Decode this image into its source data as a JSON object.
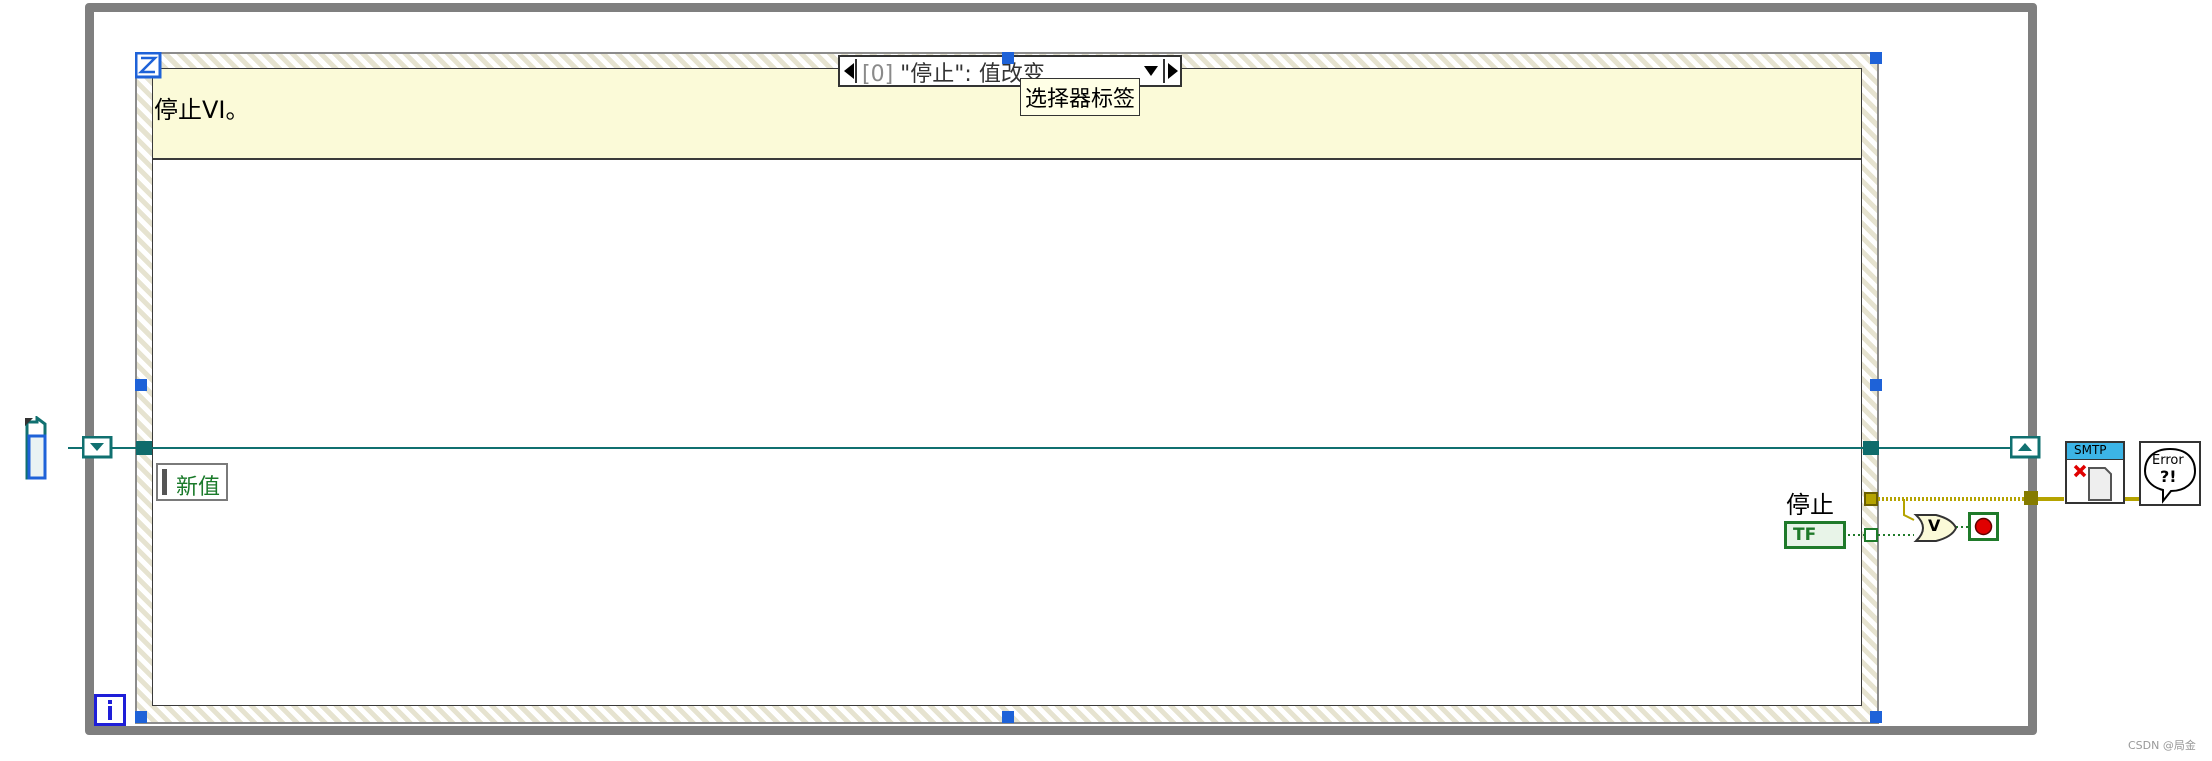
{
  "event_structure": {
    "selector_index": "[0]",
    "selector_text": "\"停止\": 值改变",
    "tooltip": "选择器标签",
    "description": "停止VI。",
    "event_data_field": "新值"
  },
  "stop_control": {
    "label": "停止",
    "terminal_text": "TF"
  },
  "or_node_text": "V",
  "smtp_icon_text": "SMTP",
  "error_icon_text": "Error",
  "error_icon_sub": "?!",
  "watermark": "CSDN @局金",
  "colors": {
    "loop_border": "#7f7f7f",
    "event_wire": "#107070",
    "error_wire": "#b5a300",
    "bool_wire": "#1f7a2a",
    "stop_terminal": "#e00000"
  }
}
